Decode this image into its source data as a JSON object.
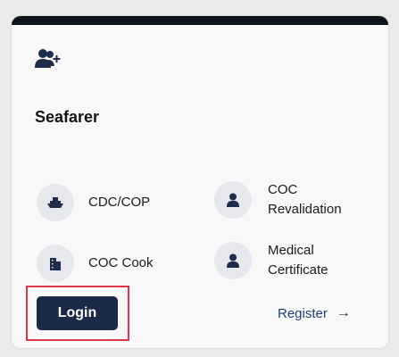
{
  "card": {
    "title": "Seafarer",
    "header_icon": "user-add-icon"
  },
  "services": [
    {
      "label": "CDC/COP",
      "icon": "ship-icon"
    },
    {
      "label": "COC Revalidation",
      "icon": "user-icon"
    },
    {
      "label": "COC Cook",
      "icon": "building-icon"
    },
    {
      "label": "Medical Certificate",
      "icon": "user-icon"
    }
  ],
  "actions": {
    "login_label": "Login",
    "register_label": "Register",
    "register_arrow": "→"
  },
  "colors": {
    "primary": "#1c2a4a",
    "highlight": "#e0344b",
    "link": "#1f3d78"
  }
}
